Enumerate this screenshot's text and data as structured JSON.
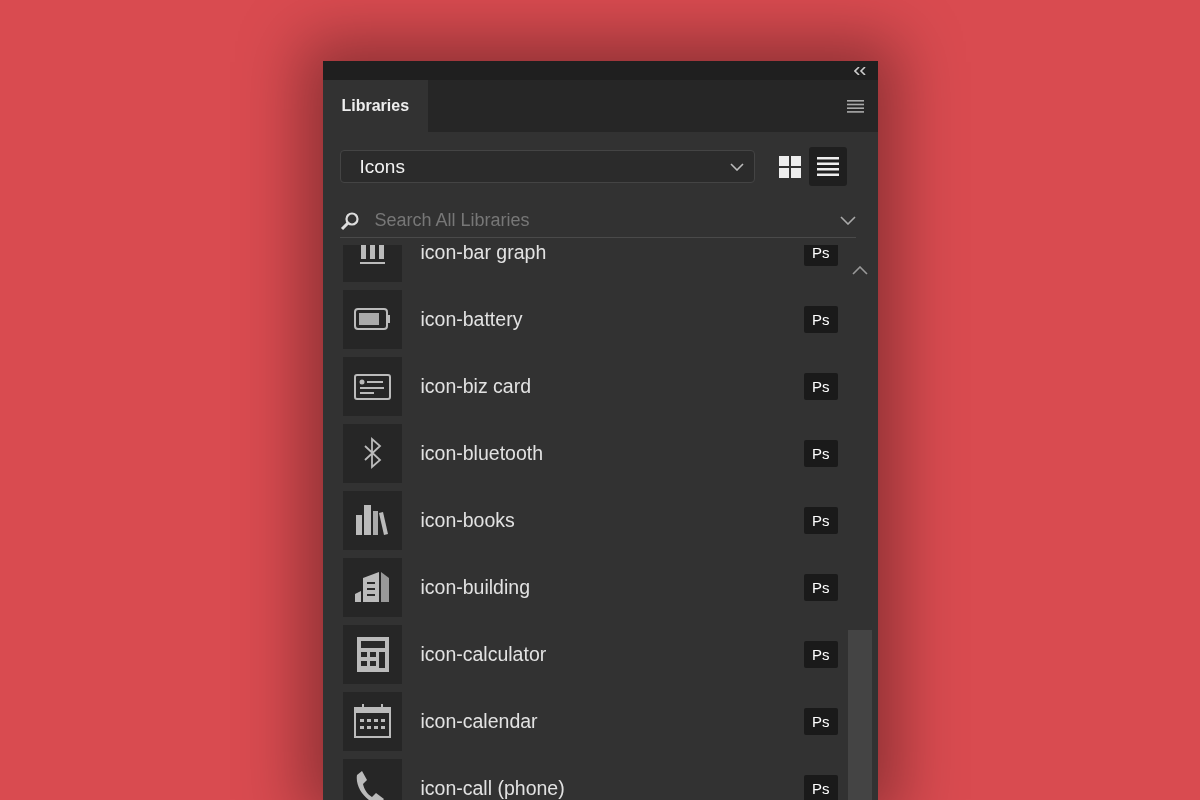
{
  "panel": {
    "tabs": [
      {
        "label": "Libraries",
        "selected": true
      }
    ]
  },
  "library_dropdown": {
    "value": "Icons"
  },
  "view_buttons": [
    {
      "kind": "grid",
      "selected": false
    },
    {
      "kind": "list",
      "selected": true
    }
  ],
  "search": {
    "placeholder": "Search All Libraries"
  },
  "items": [
    {
      "name": "icon-bar graph",
      "badge": "Ps"
    },
    {
      "name": "icon-battery",
      "badge": "Ps"
    },
    {
      "name": "icon-biz card",
      "badge": "Ps"
    },
    {
      "name": "icon-bluetooth",
      "badge": "Ps"
    },
    {
      "name": "icon-books",
      "badge": "Ps"
    },
    {
      "name": "icon-building",
      "badge": "Ps"
    },
    {
      "name": "icon-calculator",
      "badge": "Ps"
    },
    {
      "name": "icon-calendar",
      "badge": "Ps"
    },
    {
      "name": "icon-call (phone)",
      "badge": "Ps"
    }
  ]
}
